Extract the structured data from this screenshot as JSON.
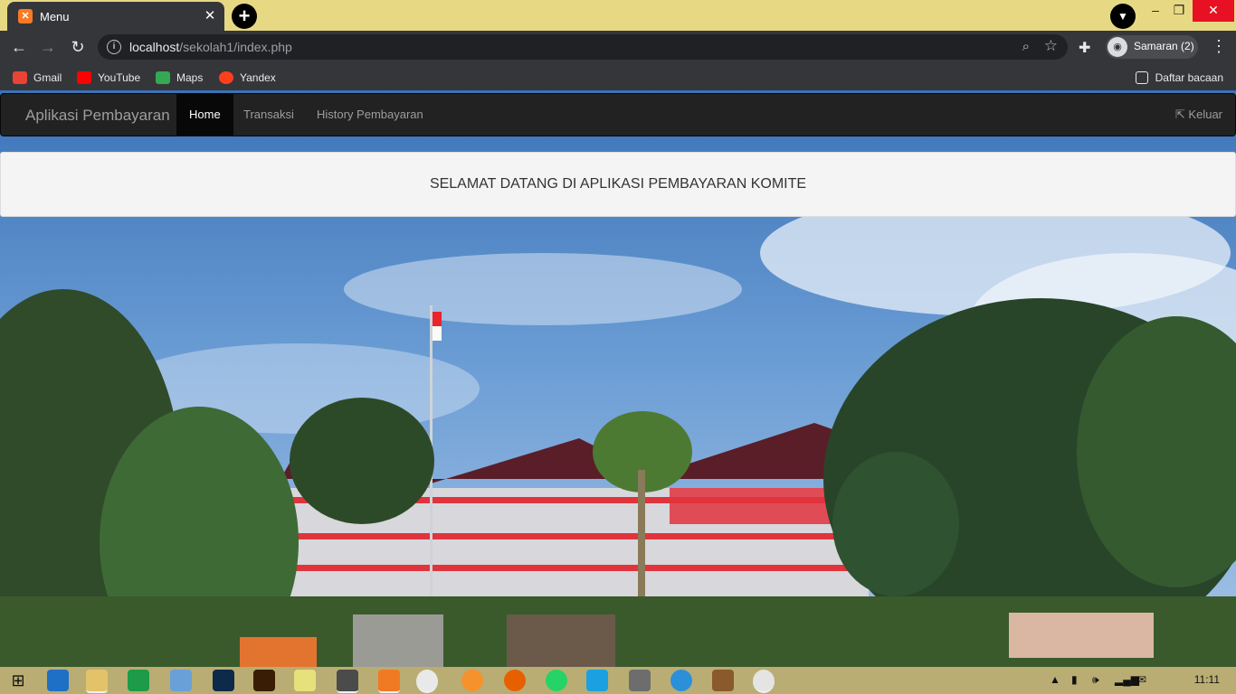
{
  "browser": {
    "tab_title": "Menu",
    "tab_icon": "xampp-icon",
    "url_host": "localhost",
    "url_path": "/sekolah1/index.php",
    "profile_label": "Samaran (2)",
    "bookmarks": [
      {
        "label": "Gmail",
        "icon": "gmail-icon",
        "color": "#ea4335"
      },
      {
        "label": "YouTube",
        "icon": "youtube-icon",
        "color": "#ff0000"
      },
      {
        "label": "Maps",
        "icon": "maps-icon",
        "color": "#34a853"
      },
      {
        "label": "Yandex",
        "icon": "yandex-icon",
        "color": "#fc3f1d"
      }
    ],
    "reading_list": "Daftar bacaan"
  },
  "app": {
    "brand": "Aplikasi Pembayaran",
    "nav": [
      {
        "label": "Home",
        "active": true
      },
      {
        "label": "Transaksi",
        "active": false
      },
      {
        "label": "History Pembayaran",
        "active": false
      }
    ],
    "logout": "Keluar",
    "welcome": "SELAMAT DATANG DI APLIKASI PEMBAYARAN KOMITE"
  },
  "taskbar": {
    "clock": "11:11"
  }
}
